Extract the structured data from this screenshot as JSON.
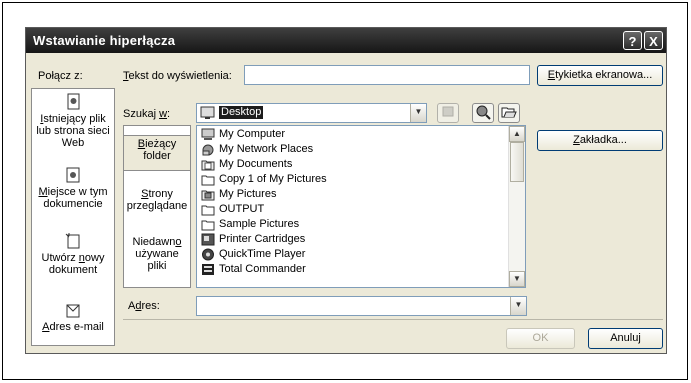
{
  "dialog": {
    "title": "Wstawianie hiperłącza",
    "help_btn": "?",
    "close_btn": "X"
  },
  "link_to": {
    "label": "Połącz z:",
    "items": [
      {
        "id": "existing",
        "line1": "Istniejący plik",
        "line2": "lub strona sieci",
        "line3": "Web",
        "selected": true
      },
      {
        "id": "place",
        "line1": "Miejsce w tym",
        "line2": "dokumencie",
        "line3": "",
        "selected": false
      },
      {
        "id": "new",
        "line1": "Utwórz nowy",
        "line2": "dokument",
        "line3": "",
        "selected": false
      },
      {
        "id": "email",
        "line1": "Adres e-mail",
        "line2": "",
        "line3": "",
        "selected": false
      }
    ]
  },
  "display_text": {
    "label": "Tekst do wyświetlenia:",
    "value": ""
  },
  "screen_tip_button": "Etykietka ekranowa...",
  "look_in": {
    "label": "Szukaj w:",
    "value": "Desktop"
  },
  "bookmark_button": "Zakładka...",
  "places": [
    {
      "line1": "Bieżący",
      "line2": "folder",
      "line3": "",
      "selected": true
    },
    {
      "line1": "Strony",
      "line2": "przeglądane",
      "line3": "",
      "selected": false
    },
    {
      "line1": "Niedawno",
      "line2": "używane",
      "line3": "pliki",
      "selected": false
    }
  ],
  "files": [
    {
      "name": "My Computer",
      "icon": "computer-icon"
    },
    {
      "name": "My Network Places",
      "icon": "network-icon"
    },
    {
      "name": "My Documents",
      "icon": "documents-folder-icon"
    },
    {
      "name": "Copy 1 of My Pictures",
      "icon": "folder-icon"
    },
    {
      "name": "My Pictures",
      "icon": "pictures-folder-icon"
    },
    {
      "name": "OUTPUT",
      "icon": "folder-icon"
    },
    {
      "name": "Sample Pictures",
      "icon": "folder-icon"
    },
    {
      "name": "Printer Cartridges",
      "icon": "shortcut-icon"
    },
    {
      "name": "QuickTime Player",
      "icon": "shortcut-icon"
    },
    {
      "name": "Total Commander",
      "icon": "shortcut-icon"
    }
  ],
  "address": {
    "label": "Adres:",
    "value": ""
  },
  "ok_button": "OK",
  "cancel_button": "Anuluj"
}
